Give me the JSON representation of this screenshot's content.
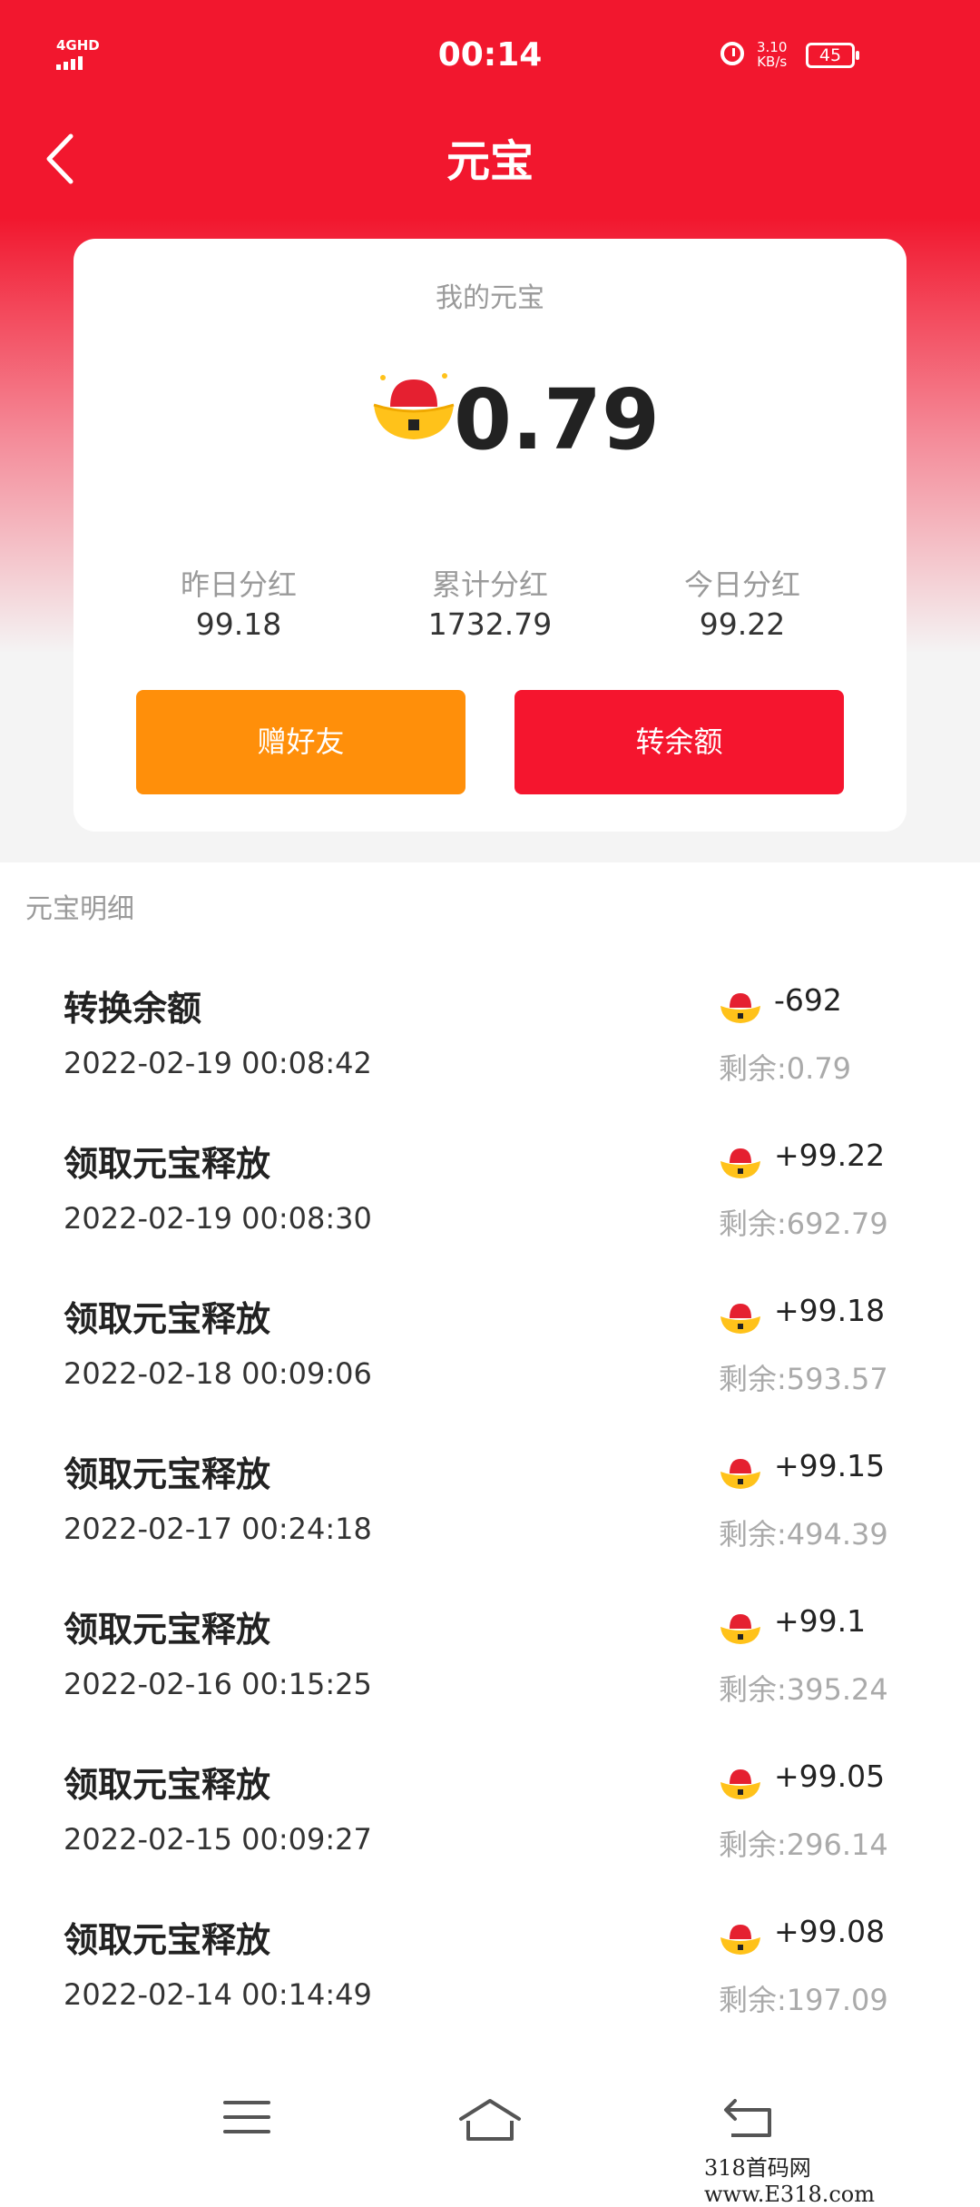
{
  "status_bar": {
    "network": "4GHD",
    "time": "00:14",
    "speed_value": "3.10",
    "speed_unit": "KB/s",
    "battery": "45",
    "icons": [
      "signal-icon",
      "alarm-icon",
      "battery-icon"
    ]
  },
  "nav": {
    "back_icon": "back-arrow-icon",
    "title": "元宝"
  },
  "card": {
    "label": "我的元宝",
    "amount": "0.79",
    "stats": [
      {
        "label": "昨日分红",
        "value": "99.18"
      },
      {
        "label": "累计分红",
        "value": "1732.79"
      },
      {
        "label": "今日分红",
        "value": "99.22"
      }
    ],
    "gift_button": "赠好友",
    "transfer_button": "转余额"
  },
  "detail": {
    "label": "元宝明细",
    "records": [
      {
        "name": "转换余额",
        "time": "2022-02-19 00:08:42",
        "delta": "-692",
        "remain": "剩余:0.79"
      },
      {
        "name": "领取元宝释放",
        "time": "2022-02-19 00:08:30",
        "delta": "+99.22",
        "remain": "剩余:692.79"
      },
      {
        "name": "领取元宝释放",
        "time": "2022-02-18 00:09:06",
        "delta": "+99.18",
        "remain": "剩余:593.57"
      },
      {
        "name": "领取元宝释放",
        "time": "2022-02-17 00:24:18",
        "delta": "+99.15",
        "remain": "剩余:494.39"
      },
      {
        "name": "领取元宝释放",
        "time": "2022-02-16 00:15:25",
        "delta": "+99.1",
        "remain": "剩余:395.24"
      },
      {
        "name": "领取元宝释放",
        "time": "2022-02-15 00:09:27",
        "delta": "+99.05",
        "remain": "剩余:296.14"
      },
      {
        "name": "领取元宝释放",
        "time": "2022-02-14 00:14:49",
        "delta": "+99.08",
        "remain": "剩余:197.09"
      }
    ]
  },
  "bottom_nav": [
    "menu-icon",
    "home-icon",
    "back-icon"
  ],
  "watermark": "318首码网 www.E318.com",
  "colors": {
    "primary_red": "#f2172e",
    "gift_orange": "#ff8f0a",
    "ingot_gold": "#ffc21a"
  }
}
